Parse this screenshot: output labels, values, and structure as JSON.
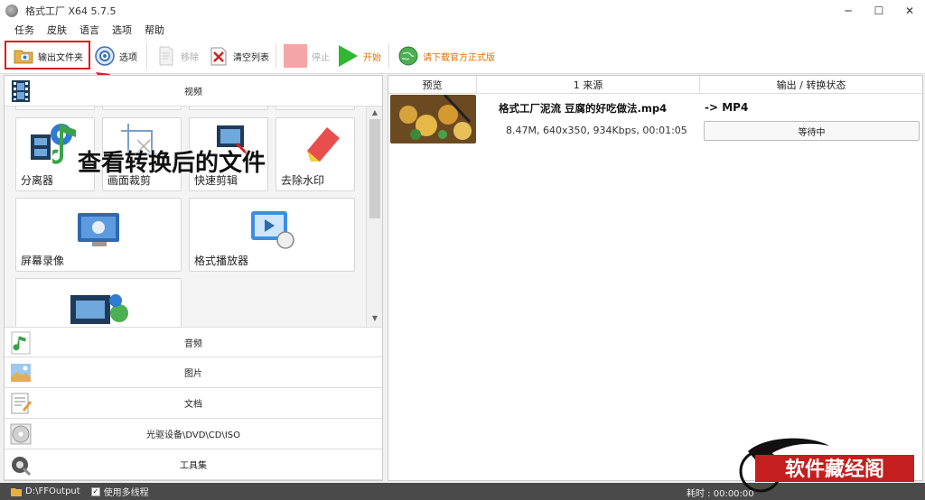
{
  "window": {
    "title": "格式工厂 X64 5.7.5"
  },
  "window_controls": {
    "minimize": "─",
    "maximize": "☐",
    "close": "✕"
  },
  "menu": [
    "任务",
    "皮肤",
    "语言",
    "选项",
    "帮助"
  ],
  "toolbar": {
    "output_folder": "输出文件夹",
    "options": "选项",
    "remove": "移除",
    "clear_list": "清空列表",
    "stop": "停止",
    "start": "开始",
    "download": "请下载官方正式版"
  },
  "left_panel": {
    "categories": {
      "video": "视频",
      "audio": "音频",
      "image": "图片",
      "document": "文档",
      "optical": "光驱设备\\DVD\\CD\\ISO",
      "toolbox": "工具集"
    },
    "tools": {
      "splitter": "分离器",
      "crop": "画面裁剪",
      "quick_clip": "快速剪辑",
      "remove_watermark": "去除水印",
      "screen_record": "屏幕录像",
      "player": "格式播放器"
    }
  },
  "annotation": {
    "text": "查看转换后的文件"
  },
  "file_list": {
    "headers": {
      "preview": "预览",
      "source": "1 来源",
      "output": "输出 / 转换状态"
    },
    "rows": [
      {
        "name": "格式工厂泥流 豆腐的好吃做法.mp4",
        "info": "8.47M, 640x350, 934Kbps, 00:01:05",
        "format": "-> MP4",
        "status": "等待中"
      }
    ]
  },
  "statusbar": {
    "path": "D:\\FFOutput",
    "multithread": "使用多线程",
    "elapsed": "耗时 : 00:00:00"
  },
  "watermark": {
    "text": "软件藏经阁"
  },
  "colors": {
    "highlight": "#d62020",
    "accent": "#e07000",
    "statusbar": "#4a4a4a"
  }
}
